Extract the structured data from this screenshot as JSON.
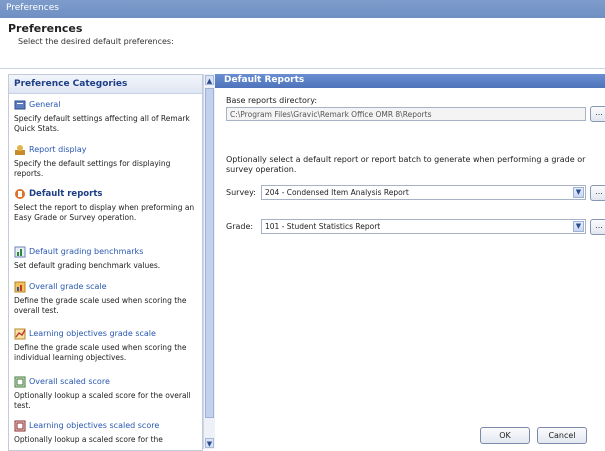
{
  "window": {
    "title": "Preferences"
  },
  "header": {
    "title": "Preferences",
    "subtitle": "Select the desired default preferences:"
  },
  "left_pane": {
    "title": "Preference Categories",
    "categories": [
      {
        "icon": "general-icon",
        "title": "General",
        "desc": "Specify default settings affecting all of Remark Quick Stats.",
        "selected": false
      },
      {
        "icon": "report-display-icon",
        "title": "Report display",
        "desc": "Specify the default settings for displaying reports.",
        "selected": false
      },
      {
        "icon": "default-reports-icon",
        "title": "Default reports",
        "desc": "Select the report to display when preforming an Easy Grade or Survey operation.",
        "selected": true
      },
      {
        "icon": "grading-benchmarks-icon",
        "title": "Default grading benchmarks",
        "desc": "Set default grading benchmark values.",
        "selected": false
      },
      {
        "icon": "grade-scale-icon",
        "title": "Overall grade scale",
        "desc": "Define the grade scale used when scoring the overall test.",
        "selected": false
      },
      {
        "icon": "learning-objectives-icon",
        "title": "Learning objectives grade scale",
        "desc": "Define the grade scale used when scoring the individual learning objectives.",
        "selected": false
      },
      {
        "icon": "scaled-score-icon",
        "title": "Overall scaled score",
        "desc": "Optionally lookup a scaled score for the overall test.",
        "selected": false
      },
      {
        "icon": "lo-scaled-score-icon",
        "title": "Learning objectives scaled score",
        "desc": "Optionally lookup a scaled score for the",
        "selected": false
      }
    ]
  },
  "right_pane": {
    "title": "Default Reports",
    "base_dir_label": "Base reports directory:",
    "base_dir_value": "C:\\Program Files\\Gravic\\Remark Office OMR 8\\Reports",
    "browse_label": "...",
    "optional_text": "Optionally select a default report or report batch to generate when performing a grade or survey operation.",
    "survey_label": "Survey:",
    "survey_value": "204 - Condensed Item Analysis Report",
    "grade_label": "Grade:",
    "grade_value": "101 - Student Statistics Report",
    "ok_label": "OK",
    "cancel_label": "Cancel"
  }
}
